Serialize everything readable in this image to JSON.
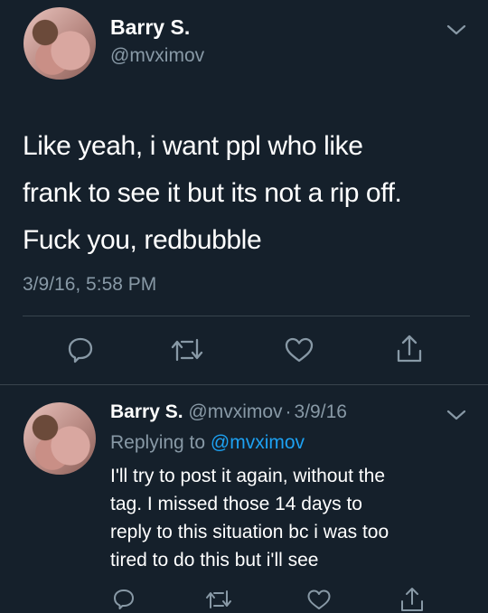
{
  "main_tweet": {
    "display_name": "Barry S.",
    "handle": "@mvximov",
    "text_lines": [
      "Like yeah, i want ppl who like",
      "frank to see it but its not a rip off.",
      "Fuck you, redbubble"
    ],
    "timestamp": "3/9/16, 5:58 PM"
  },
  "reply_tweet": {
    "display_name": "Barry S.",
    "handle": "@mvximov",
    "separator": "·",
    "date": "3/9/16",
    "replying_prefix": "Replying to",
    "replying_handle": "@mvximov",
    "text_lines": [
      "I'll try to post it again, without the",
      "tag. I missed those 14 days to",
      "reply to this situation bc i was too",
      "tired to do this but i'll see"
    ]
  },
  "icons": {
    "actions": [
      "reply-icon",
      "retweet-icon",
      "like-icon",
      "share-icon"
    ],
    "menu": "chevron-down-icon"
  },
  "colors": {
    "background": "#15202b",
    "text": "#ffffff",
    "muted": "#8899a6",
    "link": "#1da1f2",
    "divider": "#38444d"
  }
}
